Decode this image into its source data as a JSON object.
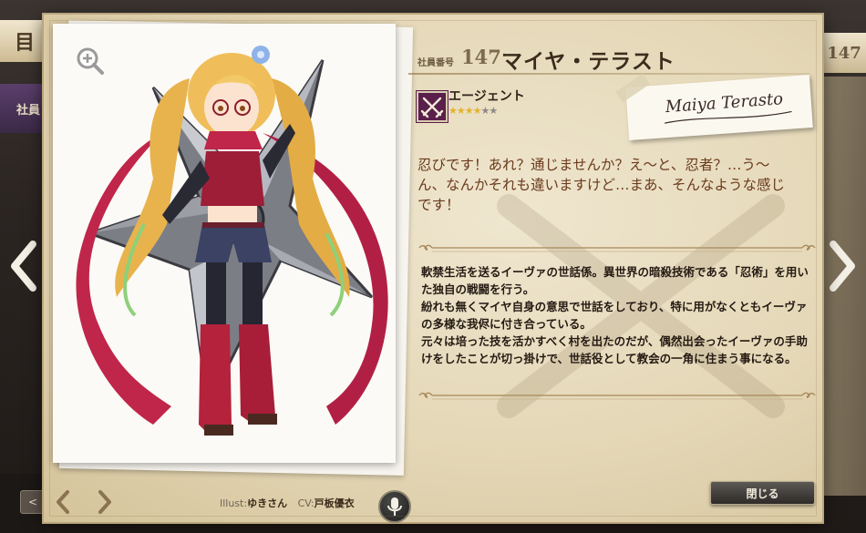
{
  "background": {
    "section_title": "目",
    "tab_label": "社員",
    "right_number": "147",
    "page_prev_small": "<"
  },
  "character": {
    "employee_label": "社員番号",
    "employee_number": "147",
    "name": "マイヤ・テラスト",
    "class_name": "エージェント",
    "class_icon": "crossed-swords-icon",
    "rarity": 4,
    "rarity_max": 6,
    "signature": "Maiya Terasto",
    "quote": "忍びです！あれ？通じませんか？え〜と、忍者？…う〜ん、なんかそれも違いますけど…まあ、そんなような感じです！",
    "description": [
      "軟禁生活を送るイーヴァの世話係。異世界の暗殺技術である「忍術」を用いた独自の戦闘を行う。",
      "紛れも無くマイヤ自身の意思で世話をしており、特に用がなくともイーヴァの多様な我侭に付き合っている。",
      "元々は培った技を活かすべく村を出たのだが、偶然出会ったイーヴァの手助けをしたことが切っ掛けで、世話役として教会の一角に住まう事になる。"
    ]
  },
  "credits": {
    "illust_label": "Illust:",
    "illust_name": "ゆきさん",
    "cv_label": "CV:",
    "cv_name": "戸板優衣"
  },
  "buttons": {
    "close_label": "閉じる"
  },
  "colors": {
    "parchment": "#e4d7b6",
    "name_text": "#3b2c1c",
    "quote_text": "#6a3a1c",
    "star_on": "#e2b32c",
    "star_off": "#8d8a86",
    "class_icon_bg": "#5a1f4a"
  }
}
